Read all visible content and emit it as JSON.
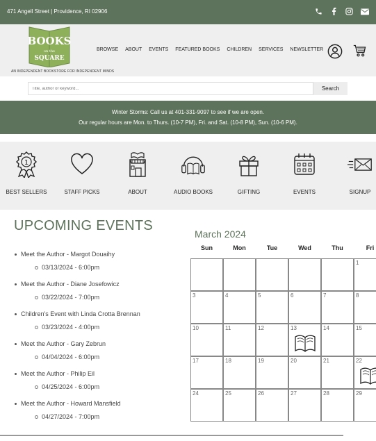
{
  "topbar": {
    "address": "471 Angell Street | Providence, RI 02906",
    "icons": [
      "phone-icon",
      "facebook-icon",
      "instagram-icon",
      "email-icon"
    ]
  },
  "header": {
    "logo_text": {
      "line1": "BOOKS",
      "line2": "on the",
      "line3": "SQUARE"
    },
    "tagline": "AN INDEPENDENT BOOKSTORE FOR INDEPENDENT MINDS",
    "nav": [
      "BROWSE",
      "ABOUT",
      "EVENTS",
      "FEATURED BOOKS",
      "CHILDREN",
      "SERVICES",
      "NEWSLETTER"
    ]
  },
  "search": {
    "placeholder": "Title, author or keyword...",
    "button": "Search"
  },
  "notice": {
    "line1": "Winter Storms: Call us at 401-331-9097 to see if we are open.",
    "line2": "Our regular hours are Mon. to Thurs. (10-7 PM), Fri. and Sat. (10-8 PM), Sun. (10-6 PM)."
  },
  "quicklinks": [
    "BEST SELLERS",
    "STAFF PICKS",
    "ABOUT",
    "AUDIO BOOKS",
    "GIFTING",
    "EVENTS",
    "SIGNUP"
  ],
  "events": {
    "heading": "UPCOMING EVENTS",
    "items": [
      {
        "title": "Meet the Author - Margot Douaihy",
        "date": "03/13/2024 - 6:00pm"
      },
      {
        "title": "Meet the Author - Diane Josefowicz",
        "date": "03/22/2024 - 7:00pm"
      },
      {
        "title": "Children's Event with Linda Crotta Brennan",
        "date": "03/23/2024 - 4:00pm"
      },
      {
        "title": "Meet the Author - Gary Zebrun",
        "date": "04/04/2024 - 6:00pm"
      },
      {
        "title": "Meet the Author - Philip Eil",
        "date": "04/25/2024 - 6:00pm"
      },
      {
        "title": "Meet the Author - Howard Mansfield",
        "date": "04/27/2024 - 7:00pm"
      }
    ]
  },
  "calendar": {
    "month": "March 2024",
    "weekdays": [
      "Sun",
      "Mon",
      "Tue",
      "Wed",
      "Thu",
      "Fri"
    ],
    "rows": [
      [
        "",
        "",
        "",
        "",
        "",
        "1"
      ],
      [
        "3",
        "4",
        "5",
        "6",
        "7",
        "8"
      ],
      [
        "10",
        "11",
        "12",
        "13",
        "14",
        "15"
      ],
      [
        "17",
        "18",
        "19",
        "20",
        "21",
        "22"
      ],
      [
        "24",
        "25",
        "26",
        "27",
        "28",
        "29"
      ]
    ],
    "event_days": [
      "13",
      "22"
    ]
  },
  "colors": {
    "brand_green": "#5e735b",
    "light_bg": "#efefef"
  }
}
